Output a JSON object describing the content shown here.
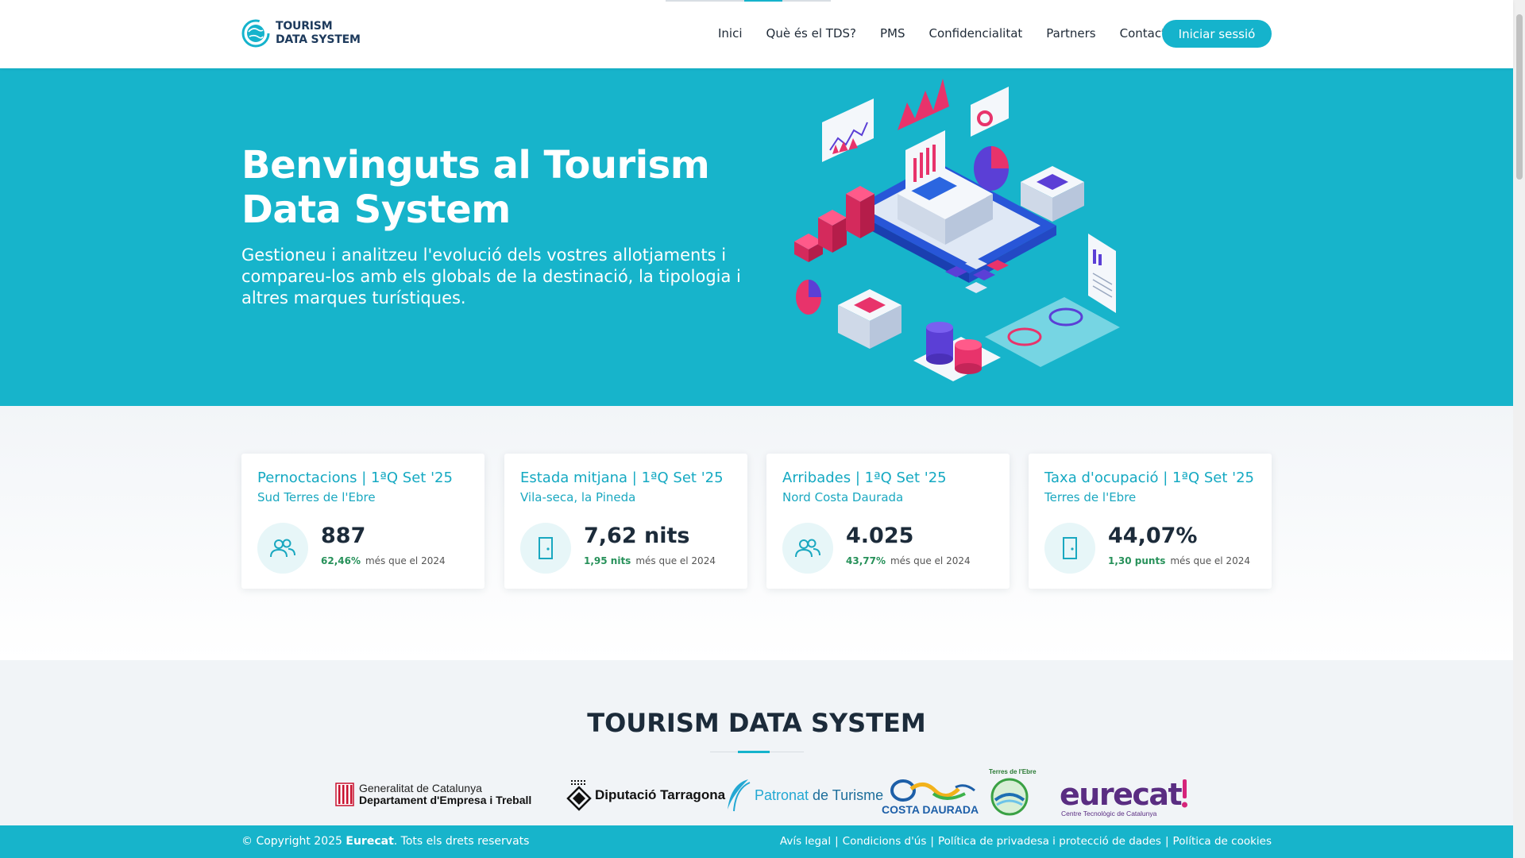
{
  "header": {
    "logo_line1": "TOURISM",
    "logo_line2": "DATA SYSTEM",
    "nav": [
      "Inici",
      "Què és el TDS?",
      "PMS",
      "Confidencialitat",
      "Partners",
      "Contacte"
    ],
    "login_label": "Iniciar sessió"
  },
  "hero": {
    "title": "Benvinguts al Tourism Data System",
    "subtitle": "Gestioneu i analitzeu l'evolució dels vostres allotjaments i compareu-los amb els globals de la destinació, la tipologia i altres marques turístiques."
  },
  "stats": [
    {
      "title": "Pernoctacions | 1ªQ Set '25",
      "subtitle": "Sud Terres de l'Ebre",
      "value": "887",
      "delta": "62,46%",
      "delta_text": "més que el 2024",
      "icon": "people-icon"
    },
    {
      "title": "Estada mitjana | 1ªQ Set '25",
      "subtitle": "Vila-seca, la Pineda",
      "value": "7,62 nits",
      "delta": "1,95 nits",
      "delta_text": "més que el 2024",
      "icon": "door-icon"
    },
    {
      "title": "Arribades | 1ªQ Set '25",
      "subtitle": "Nord Costa Daurada",
      "value": "4.025",
      "delta": "43,77%",
      "delta_text": "més que el 2024",
      "icon": "people-icon"
    },
    {
      "title": "Taxa d'ocupació | 1ªQ Set '25",
      "subtitle": "Terres de l'Ebre",
      "value": "44,07%",
      "delta": "1,30 punts",
      "delta_text": "més que el 2024",
      "icon": "door-icon"
    }
  ],
  "partners": {
    "title": "TOURISM DATA SYSTEM",
    "generalitat_line1": "Generalitat de Catalunya",
    "generalitat_line2": "Departament d'Empresa i Treball",
    "diputacio": "Diputació Tarragona",
    "patronat_a": "Patronat ",
    "patronat_b": "de Turisme",
    "costa_daurada": "COSTA DAURADA",
    "terres_ebre": "Terres de l'Ebre",
    "eurecat": "eurecat",
    "eurecat_sub": "Centre Tecnològic de Catalunya"
  },
  "footer": {
    "copyright_pre": "© Copyright 2025 ",
    "copyright_brand": "Eurecat",
    "copyright_post": ". Tots els drets reservats",
    "links": [
      "Avís legal",
      "Condicions d'ús",
      "Política de privadesa i protecció de dades",
      "Política de cookies"
    ]
  },
  "colors": {
    "accent": "#17b4cb",
    "dark": "#1c2b3a",
    "positive": "#27915a",
    "pink": "#e8336b",
    "purple": "#5b3fd6"
  }
}
